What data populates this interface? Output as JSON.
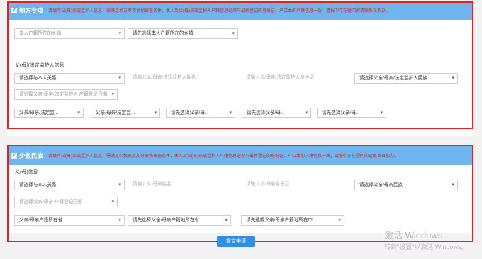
{
  "section1": {
    "title": "地方专项",
    "notice": "请填写父(母)亲或监护人信息，需满足地方专项计划审查条件，本人及父(母)亲或监护人户籍信息必须与最新登记的身份证、户口本的户籍信息一致，请报中存在疑问的请联系县招办。",
    "town_select": "本人户籍所在的乡镇",
    "town_select2": "请先选择本人户籍所在的乡镇",
    "guardian_label": "父(母)/法定监护人信息:",
    "relation": "请选择与本人关系",
    "name_placeholder": "请输入父/母亲/法定监护人姓名",
    "id_placeholder": "请输入父/母亲/法定监护人身份证",
    "ethnic": "请选择父亲/母亲/法定监护人民族",
    "date_placeholder": "请选择父亲/母亲/法定监护人 户籍登记日期",
    "loc1": "父亲/母亲/法定监...",
    "loc2": "父亲/母亲/法定监...",
    "loc3": "请先选择父亲/母...",
    "loc4": "请先选择父亲/母...",
    "loc5": "请先选择父亲/母..."
  },
  "section2": {
    "title": "少数民族",
    "notice": "请填写父(母)亲或监护人信息，需满足少数民族加分资格审查条件，本人及父(母)亲或监护人户籍信息必须与最新登记的身份证、户口本的户籍信息一致，请报中存在疑问的请联系县招办。",
    "parent_label": "父(母)信息:",
    "relation": "请选择与本人关系",
    "name_placeholder": "请输入父/母亲姓名",
    "id_placeholder": "请输入父/母亲身份证",
    "ethnic": "请选择父亲/母亲民族",
    "date_placeholder": "请选择父亲/母亲 户籍登记日期",
    "province": "父亲/母亲户籍所在省",
    "city": "请先选择父亲/母亲户籍地所在省",
    "county": "请先选择父亲/母亲户籍地所在市"
  },
  "submit_label": "提交申请",
  "watermark": {
    "line1": "激活 Windows",
    "line2": "转到\"设置\"以激活 Windows。"
  },
  "colors": {
    "header": "#6fb6f1",
    "highlight": "#e0231c",
    "notice": "#d4221b",
    "button": "#2f8fe8"
  }
}
